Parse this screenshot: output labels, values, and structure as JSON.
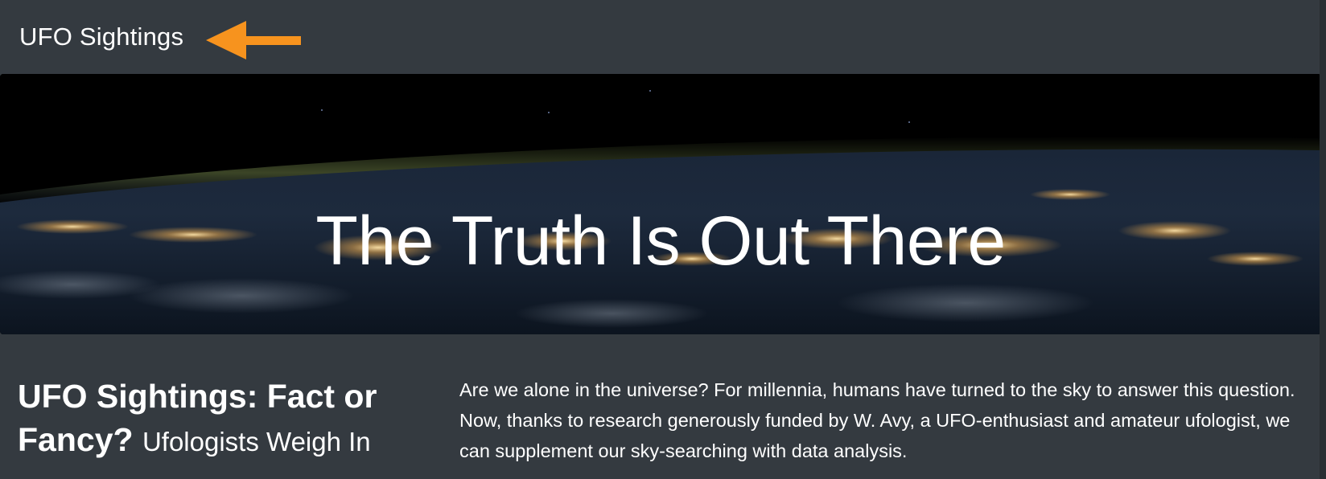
{
  "navbar": {
    "brand": "UFO Sightings",
    "arrow_color": "#f7931e"
  },
  "hero": {
    "title": "The Truth Is Out There",
    "background_description_icon": "earth-at-night-image"
  },
  "article": {
    "heading_main": "UFO Sightings: Fact or Fancy?",
    "heading_sub": "Ufologists Weigh In",
    "intro": "Are we alone in the universe? For millennia, humans have turned to the sky to answer this question. Now, thanks to research generously funded by W. Avy, a UFO-enthusiast and amateur ufologist, we can supplement our sky-searching with data analysis."
  },
  "colors": {
    "page_background": "#343a40",
    "text": "#ffffff",
    "accent_arrow": "#f7931e"
  }
}
